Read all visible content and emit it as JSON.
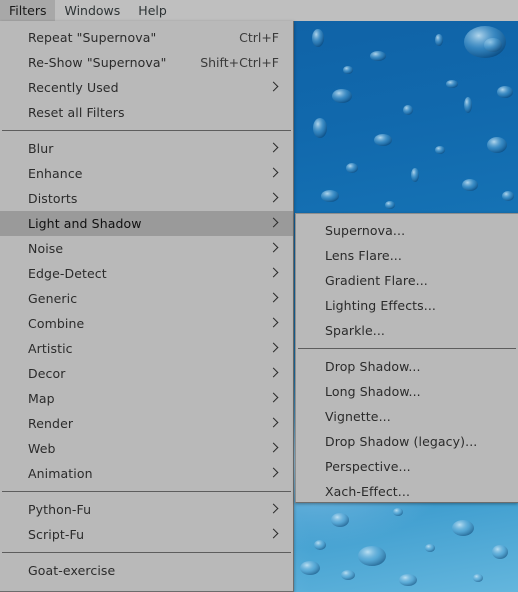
{
  "menubar": {
    "items": [
      {
        "label": "Filters",
        "active": true
      },
      {
        "label": "Windows",
        "active": false
      },
      {
        "label": "Help",
        "active": false
      }
    ]
  },
  "filters_menu": {
    "groups": [
      {
        "items": [
          {
            "label": "Repeat \"Supernova\"",
            "accel": "Ctrl+F",
            "submenu": false
          },
          {
            "label": "Re-Show \"Supernova\"",
            "accel": "Shift+Ctrl+F",
            "submenu": false
          },
          {
            "label": "Recently Used",
            "accel": "",
            "submenu": true
          },
          {
            "label": "Reset all Filters",
            "accel": "",
            "submenu": false
          }
        ]
      },
      {
        "items": [
          {
            "label": "Blur",
            "accel": "",
            "submenu": true
          },
          {
            "label": "Enhance",
            "accel": "",
            "submenu": true
          },
          {
            "label": "Distorts",
            "accel": "",
            "submenu": true
          },
          {
            "label": "Light and Shadow",
            "accel": "",
            "submenu": true,
            "highlight": true
          },
          {
            "label": "Noise",
            "accel": "",
            "submenu": true
          },
          {
            "label": "Edge-Detect",
            "accel": "",
            "submenu": true
          },
          {
            "label": "Generic",
            "accel": "",
            "submenu": true
          },
          {
            "label": "Combine",
            "accel": "",
            "submenu": true
          },
          {
            "label": "Artistic",
            "accel": "",
            "submenu": true
          },
          {
            "label": "Decor",
            "accel": "",
            "submenu": true
          },
          {
            "label": "Map",
            "accel": "",
            "submenu": true
          },
          {
            "label": "Render",
            "accel": "",
            "submenu": true
          },
          {
            "label": "Web",
            "accel": "",
            "submenu": true
          },
          {
            "label": "Animation",
            "accel": "",
            "submenu": true
          }
        ]
      },
      {
        "items": [
          {
            "label": "Python-Fu",
            "accel": "",
            "submenu": true
          },
          {
            "label": "Script-Fu",
            "accel": "",
            "submenu": true
          }
        ]
      },
      {
        "items": [
          {
            "label": "Goat-exercise",
            "accel": "",
            "submenu": false
          }
        ]
      }
    ]
  },
  "lightshadow_menu": {
    "groups": [
      {
        "items": [
          {
            "label": "Supernova...",
            "accel": "",
            "submenu": false
          },
          {
            "label": "Lens Flare...",
            "accel": "",
            "submenu": false
          },
          {
            "label": "Gradient Flare...",
            "accel": "",
            "submenu": false
          },
          {
            "label": "Lighting Effects...",
            "accel": "",
            "submenu": false
          },
          {
            "label": "Sparkle...",
            "accel": "",
            "submenu": false
          }
        ]
      },
      {
        "items": [
          {
            "label": "Drop Shadow...",
            "accel": "",
            "submenu": false
          },
          {
            "label": "Long Shadow...",
            "accel": "",
            "submenu": false
          },
          {
            "label": "Vignette...",
            "accel": "",
            "submenu": false
          },
          {
            "label": "Drop Shadow (legacy)...",
            "accel": "",
            "submenu": false
          },
          {
            "label": "Perspective...",
            "accel": "",
            "submenu": false
          },
          {
            "label": "Xach-Effect...",
            "accel": "",
            "submenu": false
          }
        ]
      }
    ]
  },
  "background": {
    "description": "water-droplets-on-blue-surface-photo",
    "base_color": "#1169ad",
    "highlight_color": "#9fd4ef"
  },
  "theme": {
    "menu_background": "#b9b9b9",
    "menubar_background": "#bfbfbf",
    "menu_highlight": "#9a9a9a",
    "menu_text": "#2b2b2b",
    "separator": "#5d5d5d"
  }
}
